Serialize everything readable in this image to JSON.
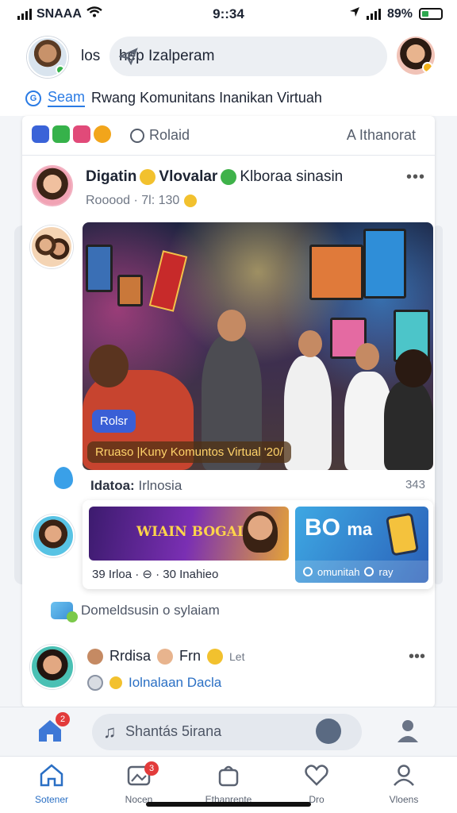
{
  "status": {
    "carrier": "SNAAA",
    "time": "9::34",
    "battery": "89%"
  },
  "header": {
    "left_label": "los",
    "search_text": "hep Izalperam",
    "sub_search": "Seam",
    "sub_title": "Rwang Komunitans Inanikan Virtuah"
  },
  "card_tabs": {
    "poll": "Rolaid",
    "honor": "A Ithanorat"
  },
  "post": {
    "title_a": "Digatin",
    "title_b": "Vlovalar",
    "title_c": "Klboraa sinasin",
    "sub": "Rooood · 7l: 130",
    "join_badge": "Rolsr",
    "caption": "Rruaso |Kuny Komuntos Virtual '20/",
    "tags_label": "Idatoa:",
    "tags_value": "Irlnosia",
    "count": "343"
  },
  "promo": {
    "promo1_text": "WIAIN BOGAL",
    "promo2_big": "BO",
    "promo2_small": "ma",
    "promo2_foot_a": "omunitah",
    "promo2_foot_b": "ray",
    "meta": "39 Irloa · ⊖ · 30 Inahieo"
  },
  "comment": {
    "text": "Domeldsusin o sylaiam"
  },
  "post2": {
    "name": "Rrdisa",
    "name2": "Frn",
    "late": "Let",
    "sub": "Iolnalaan Dacla"
  },
  "composer": {
    "placeholder": "Shantás 5irana",
    "home_count": "2"
  },
  "tabs": [
    {
      "label": "Sotener",
      "icon": "home-icon"
    },
    {
      "label": "Nocen",
      "icon": "photos-icon",
      "count": "3"
    },
    {
      "label": "Ethanrente",
      "icon": "bag-icon"
    },
    {
      "label": "Dro",
      "icon": "heart-icon"
    },
    {
      "label": "Vloens",
      "icon": "profile-icon"
    }
  ],
  "colors": {
    "accent": "#2a6fc4",
    "badge": "#e23b3b"
  }
}
